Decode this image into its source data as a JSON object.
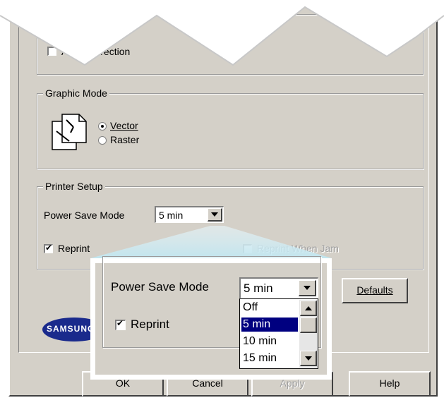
{
  "dialog": {
    "auto_correction_label": "Auto Correction",
    "graphic_mode": {
      "legend": "Graphic Mode",
      "options": [
        {
          "label": "Vector",
          "selected": true
        },
        {
          "label": "Raster",
          "selected": false
        }
      ]
    },
    "printer_setup": {
      "legend": "Printer Setup",
      "power_save_label": "Power Save Mode",
      "power_save_value": "5 min",
      "reprint_label": "Reprint",
      "reprint_checked": true,
      "reprint_when_jam_label": "Reprint When Jam"
    },
    "defaults_button": "Defaults",
    "logo_text": "SAMSUNG",
    "buttons": {
      "ok": "OK",
      "cancel": "Cancel",
      "apply": "Apply",
      "help": "Help"
    }
  },
  "zoom": {
    "power_save_label": "Power Save Mode",
    "power_save_value": "5 min",
    "reprint_label": "Reprint",
    "options": [
      "Off",
      "5 min",
      "10 min",
      "15 min"
    ],
    "highlighted": "5 min"
  },
  "colors": {
    "dialog_bg": "#d4d0c8",
    "selection": "#000080",
    "logo_blue": "#1a2a8c"
  }
}
